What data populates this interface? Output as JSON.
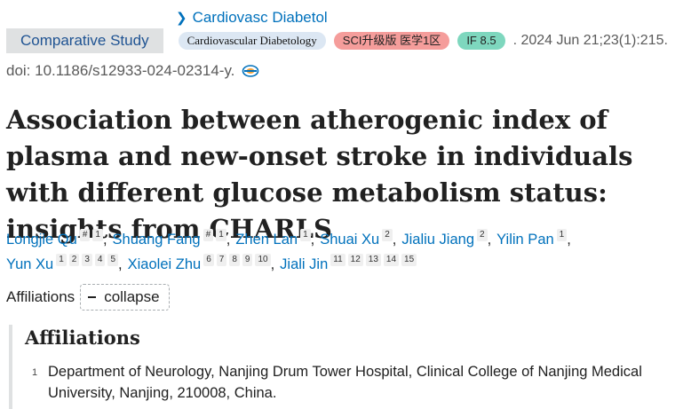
{
  "journal": {
    "link_label": "Cardiovasc Diabetol"
  },
  "meta": {
    "article_type": "Comparative Study",
    "journal_badge": "Cardiovascular Diabetology",
    "sci_badge": "SCI升级版 医学1区",
    "if_badge": "IF 8.5",
    "pub_date": ". 2024 Jun 21;23(1):215."
  },
  "doi": "doi: 10.1186/s12933-024-02314-y.",
  "title": "Association between atherogenic index of plasma and new-onset stroke in individuals with different glucose metabolism status: insights from CHARLS",
  "authors": [
    {
      "name": "Longjie Qu",
      "sups": [
        "#",
        "1"
      ]
    },
    {
      "name": "Shuang Fang",
      "sups": [
        "#",
        "1"
      ]
    },
    {
      "name": "Zhen Lan",
      "sups": [
        "1"
      ]
    },
    {
      "name": "Shuai Xu",
      "sups": [
        "2"
      ]
    },
    {
      "name": "Jialiu Jiang",
      "sups": [
        "2"
      ]
    },
    {
      "name": "Yilin Pan",
      "sups": [
        "1"
      ]
    },
    {
      "name": "Yun Xu",
      "sups": [
        "1",
        "2",
        "3",
        "4",
        "5"
      ]
    },
    {
      "name": "Xiaolei Zhu",
      "sups": [
        "6",
        "7",
        "8",
        "9",
        "10"
      ]
    },
    {
      "name": "Jiali Jin",
      "sups": [
        "11",
        "12",
        "13",
        "14",
        "15"
      ]
    }
  ],
  "affiliations": {
    "toggle_label": "Affiliations",
    "collapse_label": "collapse",
    "heading": "Affiliations",
    "items": [
      {
        "num": "1",
        "text": "Department of Neurology, Nanjing Drum Tower Hospital, Clinical College of Nanjing Medical University, Nanjing, 210008, China."
      }
    ]
  }
}
